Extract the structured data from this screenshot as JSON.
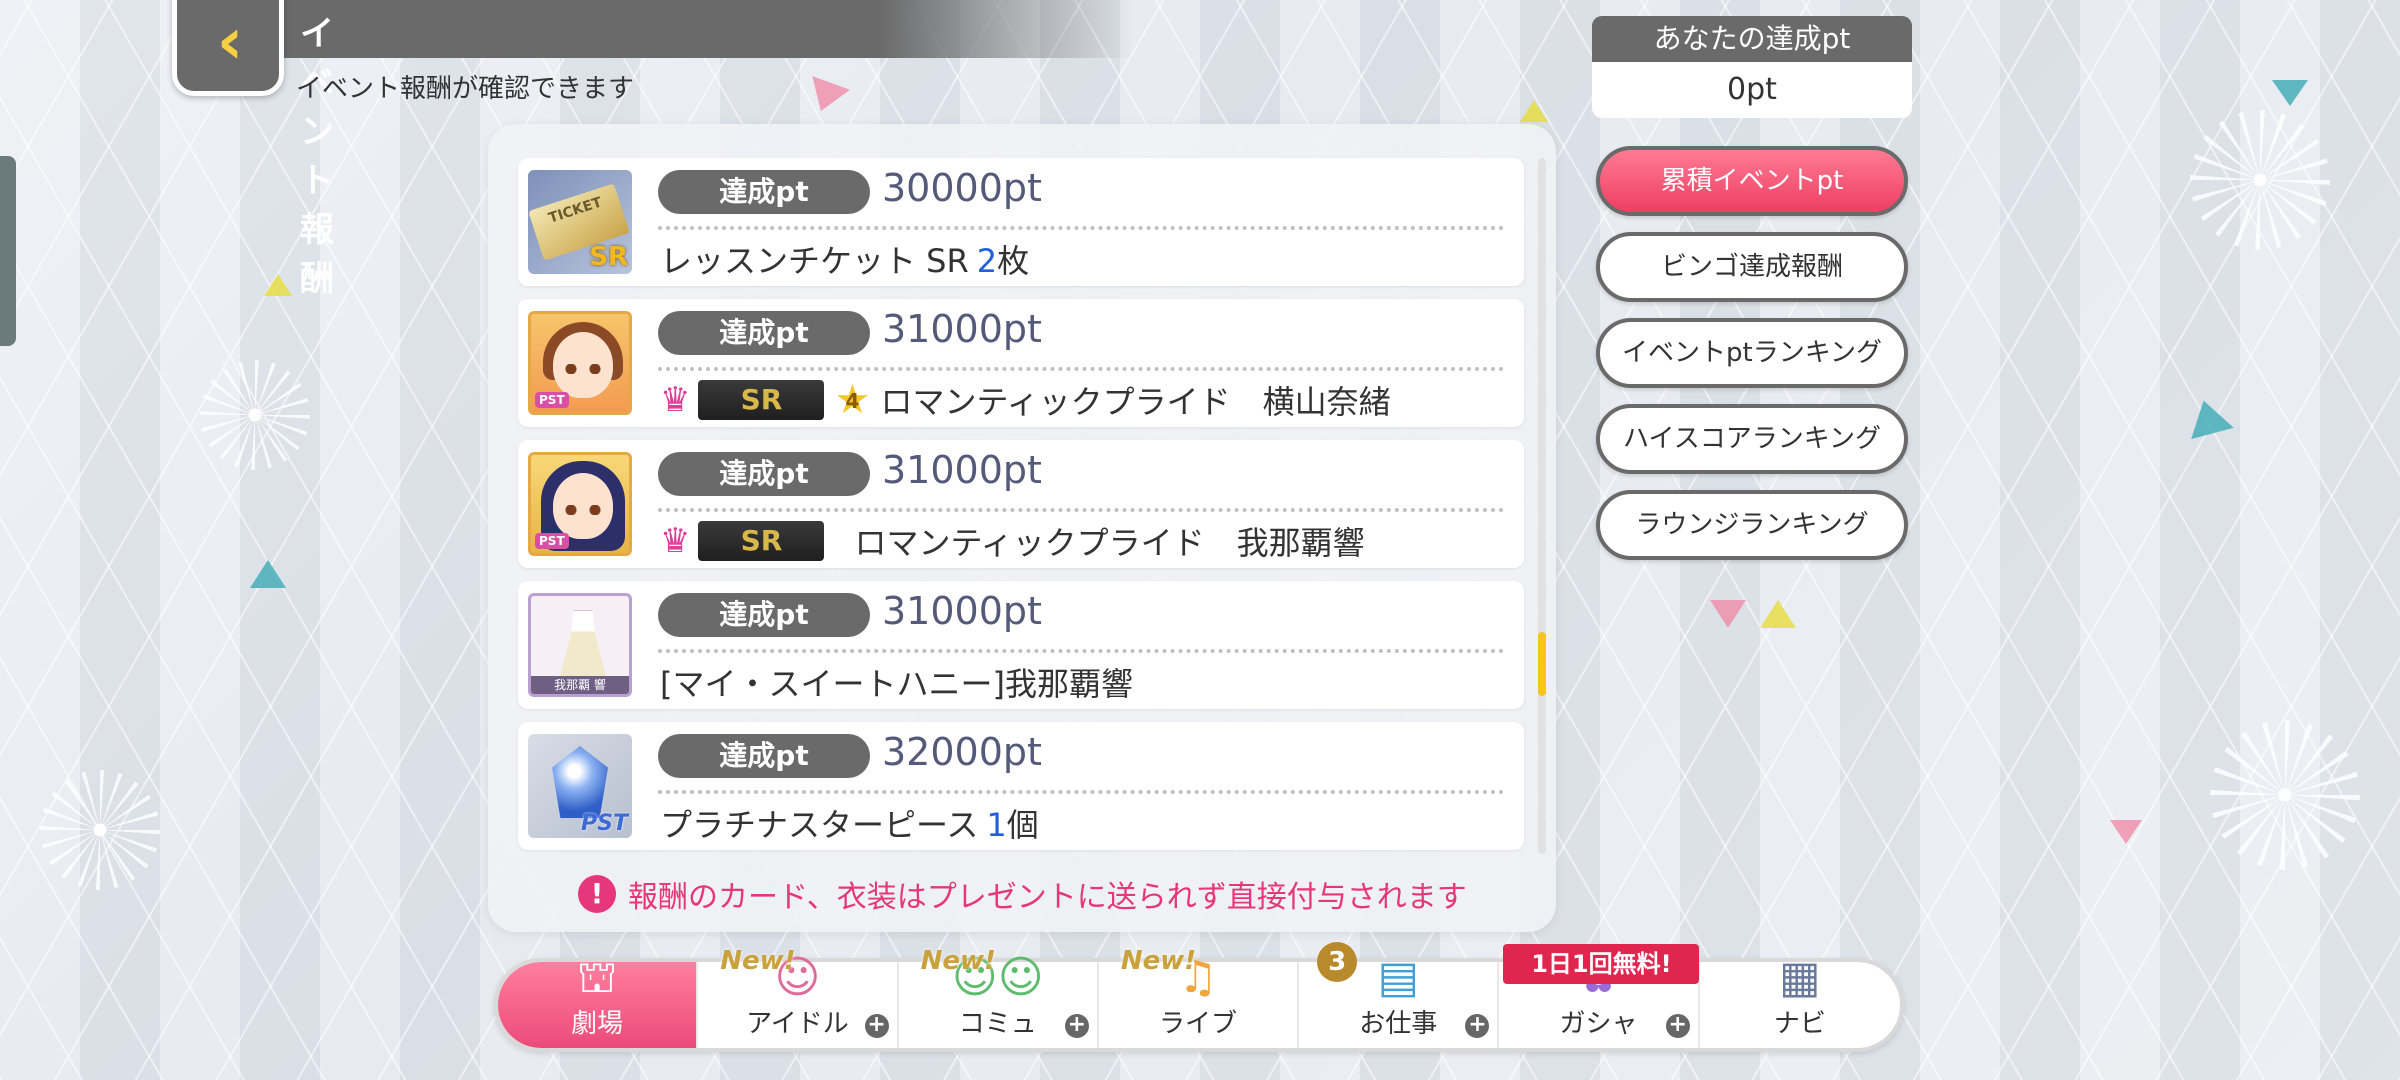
{
  "header": {
    "title": "イベント報酬",
    "subtitle": "イベント報酬が確認できます",
    "back_icon": "chevron-left-icon"
  },
  "achieved": {
    "label": "あなたの達成pt",
    "value": "0pt"
  },
  "side_buttons": [
    {
      "label": "累積イベントpt",
      "active": true
    },
    {
      "label": "ビンゴ達成報酬",
      "active": false
    },
    {
      "label": "イベントptランキング",
      "active": false
    },
    {
      "label": "ハイスコアランキング",
      "active": false
    },
    {
      "label": "ラウンジランキング",
      "active": false
    }
  ],
  "rewards": [
    {
      "pill": "達成pt",
      "points": "30000pt",
      "name": "レッスンチケット SR",
      "qty": "2",
      "unit": "枚",
      "thumb": "ticket-sr-icon",
      "thumb_text": "TICKET",
      "thumb_badge": "SR"
    },
    {
      "pill": "達成pt",
      "points": "31000pt",
      "rarity": "SR",
      "level": "4",
      "name": "ロマンティックプライド　横山奈緒",
      "thumb": "idol-card-icon",
      "thumb_badge": "PST"
    },
    {
      "pill": "達成pt",
      "points": "31000pt",
      "rarity": "SR",
      "name": "ロマンティックプライド　我那覇響",
      "thumb": "idol-card-icon",
      "thumb_badge": "PST"
    },
    {
      "pill": "達成pt",
      "points": "31000pt",
      "name": "[マイ・スイートハニー]我那覇響",
      "thumb": "costume-icon",
      "thumb_text": "我那覇 響"
    },
    {
      "pill": "達成pt",
      "points": "32000pt",
      "name": "プラチナスターピース",
      "qty": "1",
      "unit": "個",
      "thumb": "gem-icon",
      "thumb_badge": "PST"
    }
  ],
  "notice": {
    "icon": "!",
    "text": "報酬のカード、衣装はプレゼントに送られず直接付与されます"
  },
  "nav": [
    {
      "label": "劇場",
      "icon": "theater-icon",
      "active": true
    },
    {
      "label": "アイドル",
      "icon": "idol-icon",
      "badge": "New!",
      "plus": true
    },
    {
      "label": "コミュ",
      "icon": "commu-icon",
      "badge": "New!",
      "plus": true
    },
    {
      "label": "ライブ",
      "icon": "music-note-icon",
      "badge": "New!"
    },
    {
      "label": "お仕事",
      "icon": "clipboard-icon",
      "count": "3",
      "plus": true
    },
    {
      "label": "ガシャ",
      "icon": "gacha-icon",
      "free": "1日1回無料!",
      "plus": true
    },
    {
      "label": "ナビ",
      "icon": "grid-icon"
    }
  ],
  "colors": {
    "accent": "#ee3f62",
    "header_gray": "#6a6a6a",
    "qty_blue": "#2060d8",
    "notice_pink": "#e6367c"
  }
}
